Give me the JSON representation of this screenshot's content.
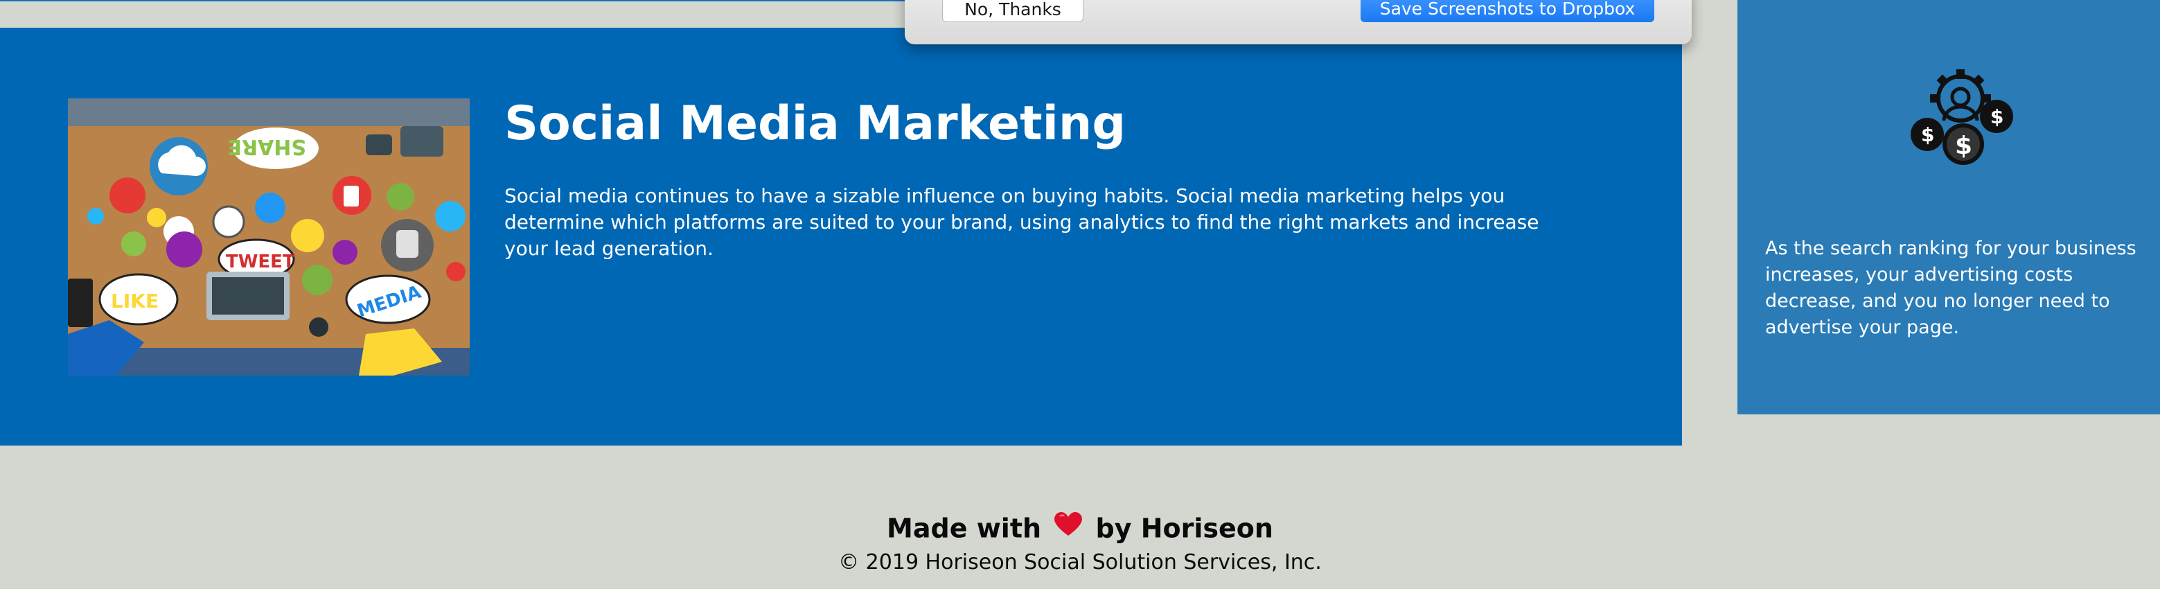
{
  "dialog": {
    "no_thanks_label": "No, Thanks",
    "save_label": "Save Screenshots to Dropbox"
  },
  "main_section": {
    "heading": "Social Media Marketing",
    "body": "Social media continues to have a sizable influence on buying habits. Social media marketing helps you determine which platforms are suited to your brand, using analytics to find the right markets and increase your lead generation.",
    "image_icon": "social-media-collage-image"
  },
  "side_card": {
    "icon": "cost-management-icon",
    "text": "As the search ranking for your business increases, your advertising costs decrease, and you no longer need to advertise your page."
  },
  "footer": {
    "made_with_prefix": "Made with",
    "made_with_suffix": "by Horiseon",
    "heart_icon": "heart-icon",
    "copyright": "© 2019 Horiseon Social Solution Services, Inc."
  },
  "colors": {
    "main_blue": "#0067b4",
    "side_blue": "#2a7bb6",
    "page_bg": "#d4d7d0",
    "dropbox_blue": "#1a78f2",
    "heart_red": "#e0102a"
  }
}
